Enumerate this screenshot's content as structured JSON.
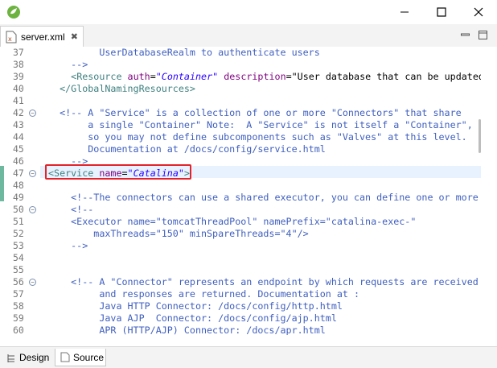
{
  "window": {
    "minimize_label": "minimize",
    "maximize_label": "maximize",
    "close_label": "close"
  },
  "tab": {
    "title": "server.xml"
  },
  "bottom_tabs": {
    "design": "Design",
    "source": "Source"
  },
  "colors": {
    "comment": "#3f5fbf",
    "tag": "#3f7f7f",
    "attr": "#7f007f",
    "value": "#2a00ff",
    "highlight": "#e32229",
    "change_marker": "#6fb8a0"
  },
  "icons": [
    "app-icon",
    "xml-file-icon",
    "close-icon",
    "minimize-icon",
    "maximize-icon",
    "design-icon",
    "source-icon"
  ],
  "lines": [
    {
      "n": "37",
      "text": "         UserDatabaseRealm to authenticate users"
    },
    {
      "n": "38",
      "text": "    -->"
    },
    {
      "n": "39",
      "text": "    <Resource auth=\"Container\" description=\"User database that can be updated"
    },
    {
      "n": "40",
      "text": "  </GlobalNamingResources>"
    },
    {
      "n": "41",
      "text": ""
    },
    {
      "n": "42",
      "text": "  <!-- A \"Service\" is a collection of one or more \"Connectors\" that share"
    },
    {
      "n": "43",
      "text": "       a single \"Container\" Note:  A \"Service\" is not itself a \"Container\","
    },
    {
      "n": "44",
      "text": "       so you may not define subcomponents such as \"Valves\" at this level."
    },
    {
      "n": "45",
      "text": "       Documentation at /docs/config/service.html"
    },
    {
      "n": "46",
      "text": "    -->"
    },
    {
      "n": "47",
      "text": "<Service name=\"Catalina\">"
    },
    {
      "n": "48",
      "text": ""
    },
    {
      "n": "49",
      "text": "    <!--The connectors can use a shared executor, you can define one or more"
    },
    {
      "n": "50",
      "text": "    <!--"
    },
    {
      "n": "51",
      "text": "    <Executor name=\"tomcatThreadPool\" namePrefix=\"catalina-exec-\""
    },
    {
      "n": "52",
      "text": "        maxThreads=\"150\" minSpareThreads=\"4\"/>"
    },
    {
      "n": "53",
      "text": "    -->"
    },
    {
      "n": "54",
      "text": ""
    },
    {
      "n": "55",
      "text": ""
    },
    {
      "n": "56",
      "text": "    <!-- A \"Connector\" represents an endpoint by which requests are received"
    },
    {
      "n": "57",
      "text": "         and responses are returned. Documentation at :"
    },
    {
      "n": "58",
      "text": "         Java HTTP Connector: /docs/config/http.html"
    },
    {
      "n": "59",
      "text": "         Java AJP  Connector: /docs/config/ajp.html"
    },
    {
      "n": "60",
      "text": "         APR (HTTP/AJP) Connector: /docs/apr.html"
    }
  ]
}
